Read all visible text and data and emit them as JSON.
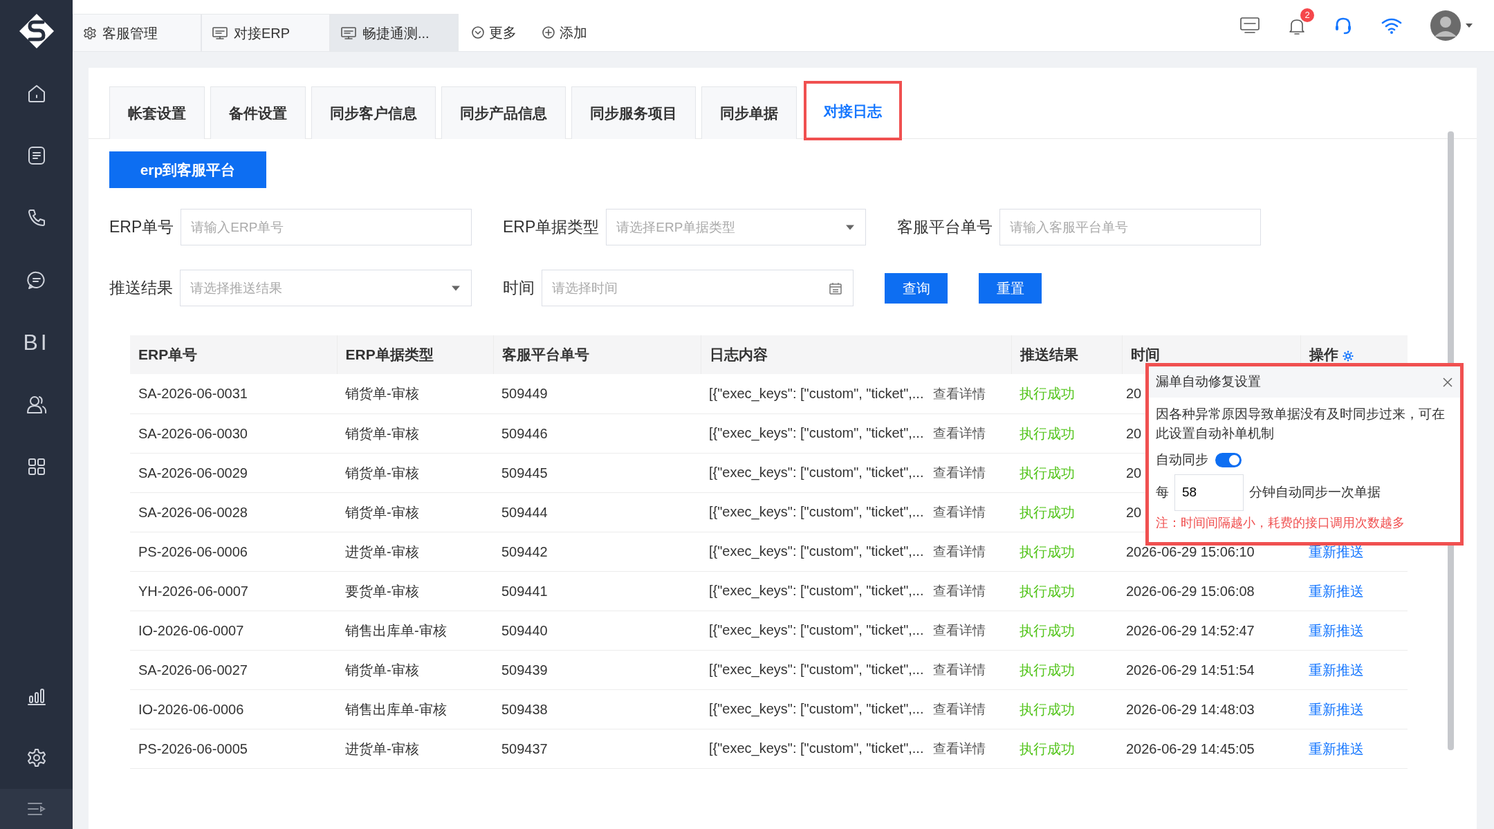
{
  "sidebar": {
    "bi_label": "BI"
  },
  "top_tabs": [
    {
      "label": "客服管理",
      "selected": false
    },
    {
      "label": "对接ERP",
      "selected": false
    },
    {
      "label": "畅捷通测...",
      "selected": true
    }
  ],
  "top_actions": [
    "更多",
    "添加"
  ],
  "notification_count": "2",
  "settings_tabs": [
    {
      "label": "帐套设置",
      "selected": false
    },
    {
      "label": "备件设置",
      "selected": false
    },
    {
      "label": "同步客户信息",
      "selected": false
    },
    {
      "label": "同步产品信息",
      "selected": false
    },
    {
      "label": "同步服务项目",
      "selected": false
    },
    {
      "label": "同步单据",
      "selected": false
    },
    {
      "label": "对接日志",
      "selected": true
    }
  ],
  "direction_button": "erp到客服平台",
  "filters": [
    {
      "kind": "text",
      "label": "ERP单号",
      "placeholder": "请输入ERP单号"
    },
    {
      "kind": "select",
      "label": "ERP单据类型",
      "placeholder": "请选择ERP单据类型"
    },
    {
      "kind": "text",
      "label": "客服平台单号",
      "placeholder": "请输入客服平台单号"
    },
    {
      "kind": "select",
      "label": "推送结果",
      "placeholder": "请选择推送结果"
    },
    {
      "kind": "date",
      "label": "时间",
      "placeholder": "请选择时间"
    }
  ],
  "buttons": [
    "查询",
    "重置"
  ],
  "table": {
    "columns": [
      "ERP单号",
      "ERP单据类型",
      "客服平台单号",
      "日志内容",
      "推送结果",
      "时间",
      "操作"
    ],
    "rows": [
      {
        "erp_no": "SA-2026-06-0031",
        "doc_type": "销货单-审核",
        "platform_no": "509449",
        "log": "[{\"exec_keys\": [\"custom\", \"ticket\",...",
        "detail": "查看详情",
        "result": "执行成功",
        "time": "20"
      },
      {
        "erp_no": "SA-2026-06-0030",
        "doc_type": "销货单-审核",
        "platform_no": "509446",
        "log": "[{\"exec_keys\": [\"custom\", \"ticket\",...",
        "detail": "查看详情",
        "result": "执行成功",
        "time": "20"
      },
      {
        "erp_no": "SA-2026-06-0029",
        "doc_type": "销货单-审核",
        "platform_no": "509445",
        "log": "[{\"exec_keys\": [\"custom\", \"ticket\",...",
        "detail": "查看详情",
        "result": "执行成功",
        "time": "20"
      },
      {
        "erp_no": "SA-2026-06-0028",
        "doc_type": "销货单-审核",
        "platform_no": "509444",
        "log": "[{\"exec_keys\": [\"custom\", \"ticket\",...",
        "detail": "查看详情",
        "result": "执行成功",
        "time": "20"
      },
      {
        "erp_no": "PS-2026-06-0006",
        "doc_type": "进货单-审核",
        "platform_no": "509442",
        "log": "[{\"exec_keys\": [\"custom\", \"ticket\",...",
        "detail": "查看详情",
        "result": "执行成功",
        "time": "2026-06-29 15:06:10",
        "action": "重新推送"
      },
      {
        "erp_no": "YH-2026-06-0007",
        "doc_type": "要货单-审核",
        "platform_no": "509441",
        "log": "[{\"exec_keys\": [\"custom\", \"ticket\",...",
        "detail": "查看详情",
        "result": "执行成功",
        "time": "2026-06-29 15:06:08",
        "action": "重新推送"
      },
      {
        "erp_no": "IO-2026-06-0007",
        "doc_type": "销售出库单-审核",
        "platform_no": "509440",
        "log": "[{\"exec_keys\": [\"custom\", \"ticket\",...",
        "detail": "查看详情",
        "result": "执行成功",
        "time": "2026-06-29 14:52:47",
        "action": "重新推送"
      },
      {
        "erp_no": "SA-2026-06-0027",
        "doc_type": "销货单-审核",
        "platform_no": "509439",
        "log": "[{\"exec_keys\": [\"custom\", \"ticket\",...",
        "detail": "查看详情",
        "result": "执行成功",
        "time": "2026-06-29 14:51:54",
        "action": "重新推送"
      },
      {
        "erp_no": "IO-2026-06-0006",
        "doc_type": "销售出库单-审核",
        "platform_no": "509438",
        "log": "[{\"exec_keys\": [\"custom\", \"ticket\",...",
        "detail": "查看详情",
        "result": "执行成功",
        "time": "2026-06-29 14:48:03",
        "action": "重新推送"
      },
      {
        "erp_no": "PS-2026-06-0005",
        "doc_type": "进货单-审核",
        "platform_no": "509437",
        "log": "[{\"exec_keys\": [\"custom\", \"ticket\",...",
        "detail": "查看详情",
        "result": "执行成功",
        "time": "2026-06-29 14:45:05",
        "action": "重新推送"
      }
    ]
  },
  "popup": {
    "title": "漏单自动修复设置",
    "description": "因各种异常原因导致单据没有及时同步过来，可在此设置自动补单机制",
    "toggle_label": "自动同步",
    "auto_sync": true,
    "interval_prefix": "每",
    "interval_value": "58",
    "interval_suffix": "分钟自动同步一次单据",
    "note": "注：时间间隔越小，耗费的接口调用次数越多"
  }
}
